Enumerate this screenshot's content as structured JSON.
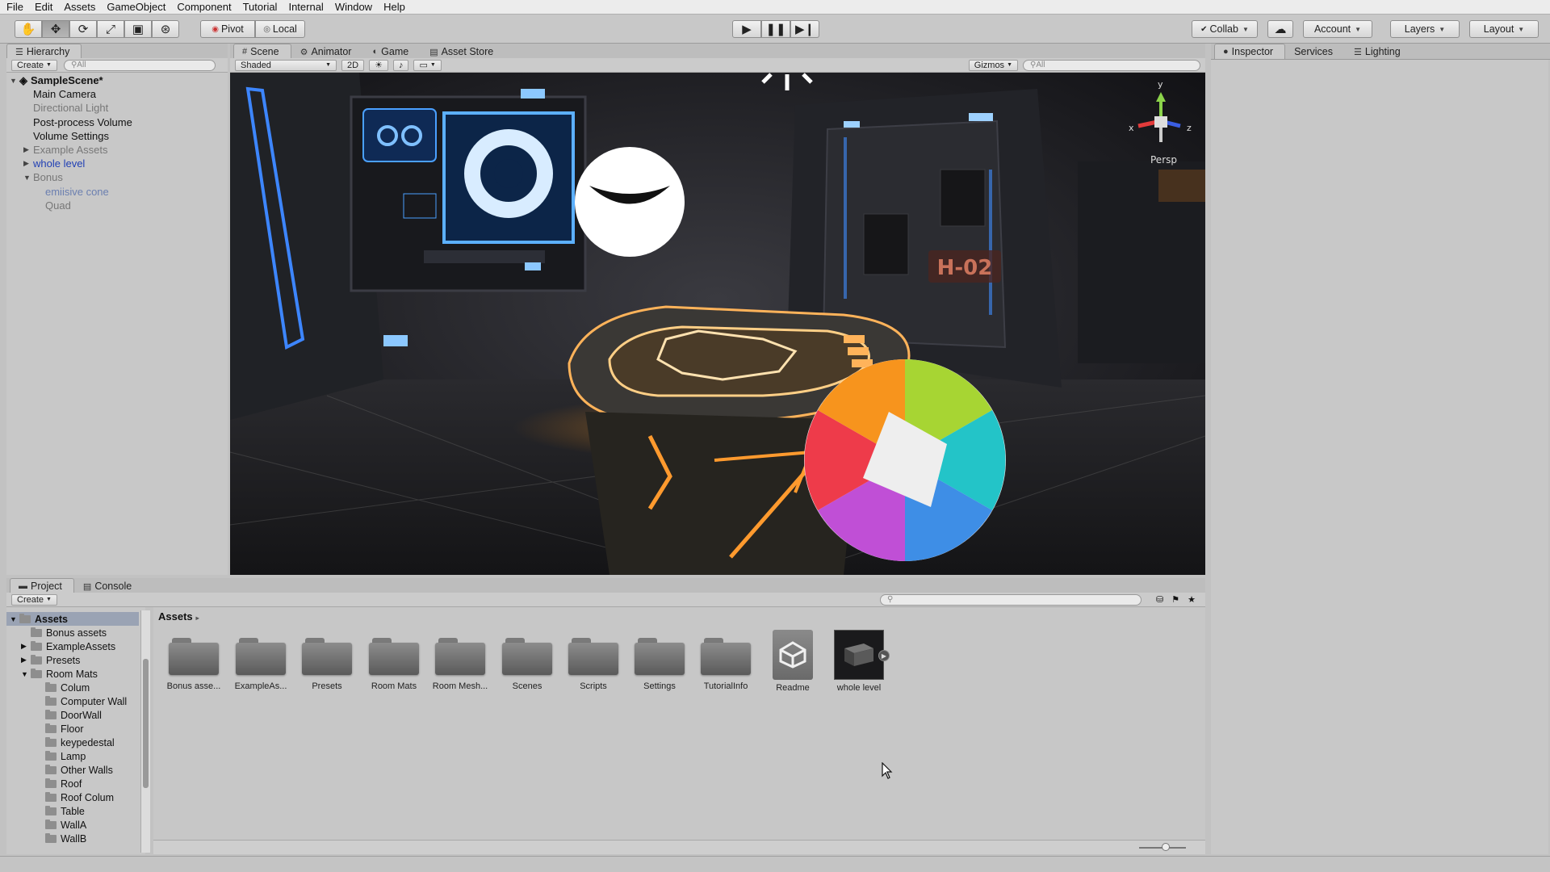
{
  "menu": [
    "File",
    "Edit",
    "Assets",
    "GameObject",
    "Component",
    "Tutorial",
    "Internal",
    "Window",
    "Help"
  ],
  "toolbar": {
    "pivot": "Pivot",
    "local": "Local",
    "collab": "Collab",
    "account": "Account",
    "layers": "Layers",
    "layout": "Layout"
  },
  "hierarchy": {
    "tab": "Hierarchy",
    "create": "Create",
    "search_placeholder": "All",
    "scene_name": "SampleScene*",
    "items": [
      {
        "label": "Main Camera"
      },
      {
        "label": "Directional Light"
      },
      {
        "label": "Post-process Volume"
      },
      {
        "label": "Volume Settings"
      },
      {
        "label": "Example Assets"
      },
      {
        "label": "whole level"
      },
      {
        "label": "Bonus"
      },
      {
        "label": "emiisive cone"
      },
      {
        "label": "Quad"
      }
    ]
  },
  "scene": {
    "tabs": [
      "Scene",
      "Animator",
      "Game",
      "Asset Store"
    ],
    "shading": "Shaded",
    "mode_2d": "2D",
    "gizmos": "Gizmos",
    "search_placeholder": "All",
    "persp": "Persp",
    "door_label": "H-02",
    "axis_y": "y",
    "axis_x": "x",
    "axis_z": "z"
  },
  "inspector": {
    "tabs": [
      "Inspector",
      "Services",
      "Lighting"
    ]
  },
  "project": {
    "tabs": [
      "Project",
      "Console"
    ],
    "create": "Create",
    "breadcrumb": "Assets",
    "tree_root": "Assets",
    "tree": [
      {
        "label": "Bonus assets"
      },
      {
        "label": "ExampleAssets"
      },
      {
        "label": "Presets"
      },
      {
        "label": "Room Mats"
      },
      {
        "label": "Colum"
      },
      {
        "label": "Computer Wall"
      },
      {
        "label": "DoorWall"
      },
      {
        "label": "Floor"
      },
      {
        "label": "keypedestal"
      },
      {
        "label": "Lamp"
      },
      {
        "label": "Other Walls"
      },
      {
        "label": "Roof"
      },
      {
        "label": "Roof Colum"
      },
      {
        "label": "Table"
      },
      {
        "label": "WallA"
      },
      {
        "label": "WallB"
      }
    ],
    "assets": [
      {
        "label": "Bonus asse..."
      },
      {
        "label": "ExampleAs..."
      },
      {
        "label": "Presets"
      },
      {
        "label": "Room Mats"
      },
      {
        "label": "Room Mesh..."
      },
      {
        "label": "Scenes"
      },
      {
        "label": "Scripts"
      },
      {
        "label": "Settings"
      },
      {
        "label": "TutorialInfo"
      },
      {
        "label": "Readme"
      },
      {
        "label": "whole level"
      }
    ]
  },
  "colors": {
    "accent_blue": "#2140b4",
    "glow_orange": "#ff9a2e",
    "screen_blue": "#2f8bff"
  }
}
